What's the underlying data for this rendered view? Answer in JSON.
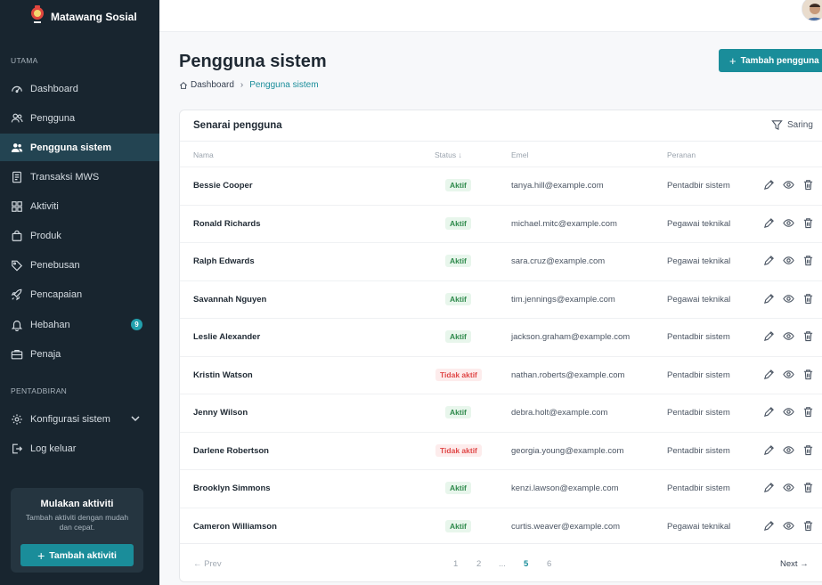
{
  "brand": {
    "name": "Matawang Sosial"
  },
  "sidebar": {
    "sections": [
      {
        "label": "UTAMA"
      },
      {
        "label": "PENTADBIRAN"
      }
    ],
    "items": [
      {
        "label": "Dashboard",
        "icon": "dashboard-icon"
      },
      {
        "label": "Pengguna",
        "icon": "users-icon"
      },
      {
        "label": "Pengguna sistem",
        "icon": "system-users-icon",
        "active": true
      },
      {
        "label": "Transaksi MWS",
        "icon": "receipt-icon"
      },
      {
        "label": "Aktiviti",
        "icon": "grid-icon"
      },
      {
        "label": "Produk",
        "icon": "bag-icon"
      },
      {
        "label": "Penebusan",
        "icon": "tag-icon"
      },
      {
        "label": "Pencapaian",
        "icon": "rocket-icon"
      },
      {
        "label": "Hebahan",
        "icon": "bell-icon",
        "badge": "9"
      },
      {
        "label": "Penaja",
        "icon": "briefcase-icon"
      },
      {
        "label": "Konfigurasi sistem",
        "icon": "gear-icon"
      },
      {
        "label": "Log keluar",
        "icon": "logout-icon"
      }
    ],
    "promo": {
      "title": "Mulakan aktiviti",
      "description": "Tambah aktiviti dengan mudah dan cepat.",
      "button": "Tambah aktiviti"
    }
  },
  "header": {
    "title": "Pengguna sistem",
    "add_button": "Tambah pengguna",
    "breadcrumb": {
      "home": "Dashboard",
      "current": "Pengguna sistem"
    }
  },
  "table": {
    "title": "Senarai pengguna",
    "filter_label": "Saring",
    "columns": [
      "Nama",
      "Status",
      "Emel",
      "Peranan"
    ],
    "rows": [
      {
        "name": "Bessie Cooper",
        "status": "Aktif",
        "active": true,
        "email": "tanya.hill@example.com",
        "role": "Pentadbir sistem"
      },
      {
        "name": "Ronald Richards",
        "status": "Aktif",
        "active": true,
        "email": "michael.mitc@example.com",
        "role": "Pegawai teknikal"
      },
      {
        "name": "Ralph Edwards",
        "status": "Aktif",
        "active": true,
        "email": "sara.cruz@example.com",
        "role": "Pegawai teknikal"
      },
      {
        "name": "Savannah Nguyen",
        "status": "Aktif",
        "active": true,
        "email": "tim.jennings@example.com",
        "role": "Pegawai teknikal"
      },
      {
        "name": "Leslie Alexander",
        "status": "Aktif",
        "active": true,
        "email": "jackson.graham@example.com",
        "role": "Pentadbir sistem"
      },
      {
        "name": "Kristin Watson",
        "status": "Tidak aktif",
        "active": false,
        "email": "nathan.roberts@example.com",
        "role": "Pentadbir sistem"
      },
      {
        "name": "Jenny Wilson",
        "status": "Aktif",
        "active": true,
        "email": "debra.holt@example.com",
        "role": "Pentadbir sistem"
      },
      {
        "name": "Darlene Robertson",
        "status": "Tidak aktif",
        "active": false,
        "email": "georgia.young@example.com",
        "role": "Pentadbir sistem"
      },
      {
        "name": "Brooklyn Simmons",
        "status": "Aktif",
        "active": true,
        "email": "kenzi.lawson@example.com",
        "role": "Pentadbir sistem"
      },
      {
        "name": "Cameron Williamson",
        "status": "Aktif",
        "active": true,
        "email": "curtis.weaver@example.com",
        "role": "Pegawai teknikal"
      }
    ],
    "pagination": {
      "prev": "Prev",
      "next": "Next",
      "pages": [
        "1",
        "2",
        "...",
        "5",
        "6"
      ],
      "current": "5"
    }
  },
  "colors": {
    "sidebar_bg": "#18252f",
    "accent": "#1a8d9a",
    "active_status": "#2f8a4c",
    "inactive_status": "#e04848"
  }
}
